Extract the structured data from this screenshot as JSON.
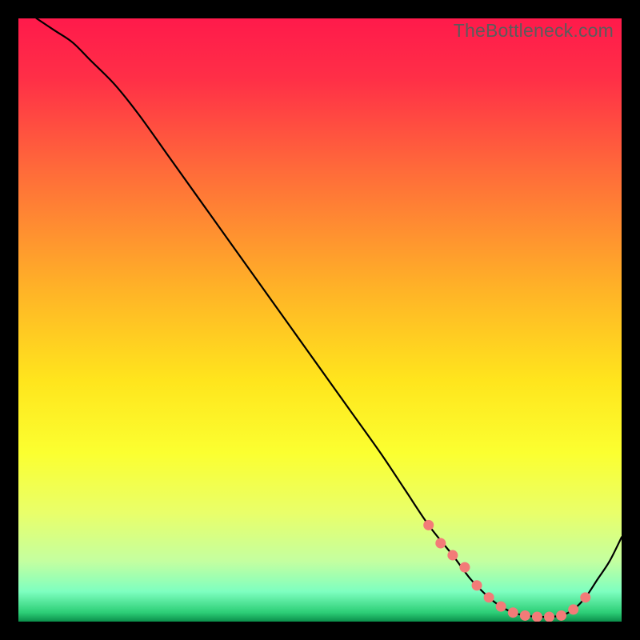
{
  "watermark": "TheBottleneck.com",
  "chart_data": {
    "type": "line",
    "title": "",
    "xlabel": "",
    "ylabel": "",
    "xlim": [
      0,
      100
    ],
    "ylim": [
      0,
      100
    ],
    "grid": false,
    "legend": false,
    "series": [
      {
        "name": "bottleneck-curve",
        "x": [
          3,
          6,
          9,
          12,
          16,
          20,
          25,
          30,
          35,
          40,
          45,
          50,
          55,
          60,
          64,
          68,
          72,
          75,
          78,
          80,
          82,
          84,
          86,
          88,
          90,
          92,
          94,
          96,
          98,
          100
        ],
        "y": [
          100,
          98,
          96,
          93,
          89,
          84,
          77,
          70,
          63,
          56,
          49,
          42,
          35,
          28,
          22,
          16,
          11,
          7,
          4,
          2.5,
          1.5,
          1,
          0.8,
          0.8,
          1,
          2,
          4,
          7,
          10,
          14
        ]
      }
    ],
    "markers": {
      "name": "highlighted-points",
      "color": "#f37b78",
      "x": [
        68,
        70,
        72,
        74,
        76,
        78,
        80,
        82,
        84,
        86,
        88,
        90,
        92,
        94
      ],
      "y": [
        16,
        13,
        11,
        9,
        6,
        4,
        2.5,
        1.5,
        1,
        0.8,
        0.8,
        1,
        2,
        4
      ]
    },
    "gradient_stops": [
      {
        "offset": 0.0,
        "color": "#ff1a4b"
      },
      {
        "offset": 0.1,
        "color": "#ff2f47"
      },
      {
        "offset": 0.25,
        "color": "#ff6a3a"
      },
      {
        "offset": 0.45,
        "color": "#ffb327"
      },
      {
        "offset": 0.6,
        "color": "#ffe51d"
      },
      {
        "offset": 0.72,
        "color": "#fbff30"
      },
      {
        "offset": 0.82,
        "color": "#e9ff6a"
      },
      {
        "offset": 0.9,
        "color": "#c4ffa0"
      },
      {
        "offset": 0.95,
        "color": "#7effc0"
      },
      {
        "offset": 0.985,
        "color": "#2cce76"
      },
      {
        "offset": 1.0,
        "color": "#0a8f4a"
      }
    ]
  }
}
